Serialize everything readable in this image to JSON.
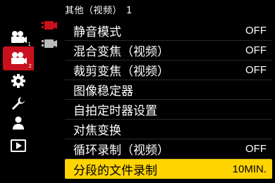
{
  "header": {
    "title": "其他（视频）",
    "page": "1"
  },
  "sidebar": {
    "items": [
      {
        "icon": "camera-settings-icon",
        "sub": "1"
      },
      {
        "icon": "video-settings-icon",
        "sub": "2",
        "active": true
      },
      {
        "icon": "gear-icon"
      },
      {
        "icon": "wrench-icon"
      },
      {
        "icon": "person-icon"
      },
      {
        "icon": "playback-icon"
      }
    ]
  },
  "subtabs": [
    {
      "icon": "video-tab-1-icon",
      "active": true
    },
    {
      "icon": "video-tab-2-icon",
      "active": false
    }
  ],
  "menu": {
    "items": [
      {
        "label": "静音模式",
        "value": "OFF"
      },
      {
        "label": "混合变焦（视频）",
        "value": "OFF"
      },
      {
        "label": "裁剪变焦（视频）",
        "value": "OFF"
      },
      {
        "label": "图像稳定器",
        "value": ""
      },
      {
        "label": "自拍定时器设置",
        "value": ""
      },
      {
        "label": "对焦变换",
        "value": ""
      },
      {
        "label": "循环录制（视频）",
        "value": "OFF"
      },
      {
        "label": "分段的文件录制",
        "value": "10MIN.",
        "selected": true
      }
    ]
  },
  "colors": {
    "accent": "#c8101e",
    "selection": "#ffd400"
  }
}
